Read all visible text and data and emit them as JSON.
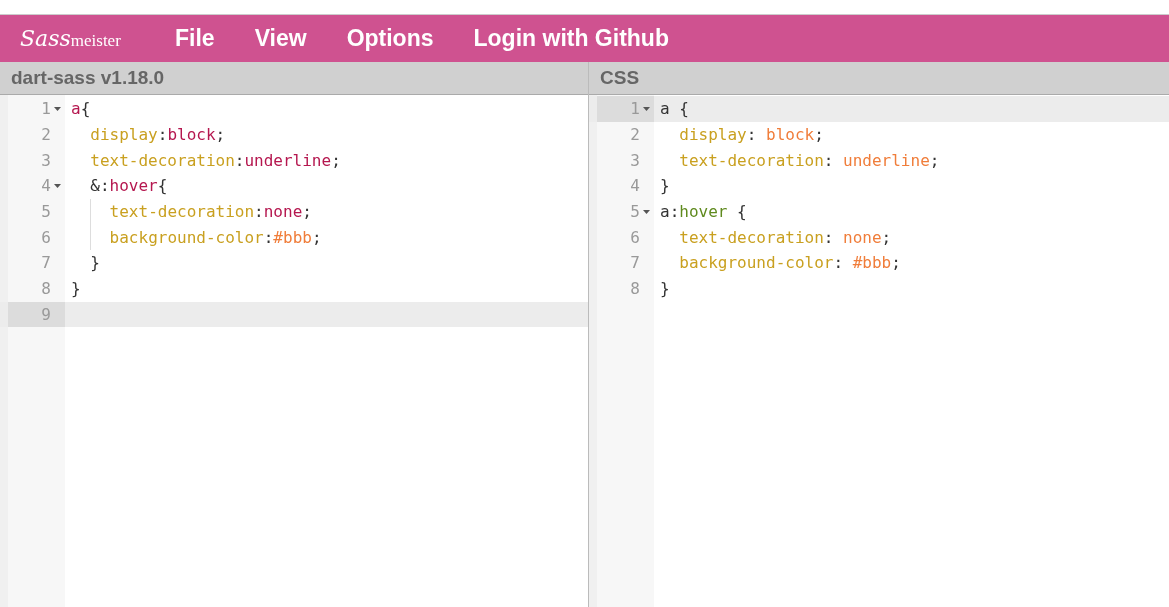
{
  "header": {
    "logo": {
      "script": "Sass",
      "rest": "meister"
    },
    "menu": [
      "File",
      "View",
      "Options",
      "Login with Github"
    ]
  },
  "panes": [
    {
      "title": "dart-sass v1.18.0",
      "lines": [
        {
          "number": "1",
          "foldable": true,
          "active": false,
          "indent": false,
          "guide": false,
          "tokens": [
            {
              "kind": "tag",
              "text": "a"
            },
            {
              "kind": "plain",
              "text": "{"
            }
          ]
        },
        {
          "number": "2",
          "foldable": false,
          "active": false,
          "indent": true,
          "guide": false,
          "tokens": [
            {
              "kind": "prop",
              "text": "display"
            },
            {
              "kind": "plain",
              "text": ":"
            },
            {
              "kind": "atom",
              "text": "block"
            },
            {
              "kind": "plain",
              "text": ";"
            }
          ]
        },
        {
          "number": "3",
          "foldable": false,
          "active": false,
          "indent": true,
          "guide": false,
          "tokens": [
            {
              "kind": "prop",
              "text": "text-decoration"
            },
            {
              "kind": "plain",
              "text": ":"
            },
            {
              "kind": "atom",
              "text": "underline"
            },
            {
              "kind": "plain",
              "text": ";"
            }
          ]
        },
        {
          "number": "4",
          "foldable": true,
          "active": false,
          "indent": true,
          "guide": false,
          "tokens": [
            {
              "kind": "plain",
              "text": "&:"
            },
            {
              "kind": "tag",
              "text": "hover"
            },
            {
              "kind": "plain",
              "text": "{"
            }
          ]
        },
        {
          "number": "5",
          "foldable": false,
          "active": false,
          "indent": true,
          "guide": true,
          "tokens": [
            {
              "kind": "prop",
              "text": "text-decoration"
            },
            {
              "kind": "plain",
              "text": ":"
            },
            {
              "kind": "atom",
              "text": "none"
            },
            {
              "kind": "plain",
              "text": ";"
            }
          ]
        },
        {
          "number": "6",
          "foldable": false,
          "active": false,
          "indent": true,
          "guide": true,
          "tokens": [
            {
              "kind": "prop",
              "text": "background-color"
            },
            {
              "kind": "plain",
              "text": ":"
            },
            {
              "kind": "value",
              "text": "#bbb"
            },
            {
              "kind": "plain",
              "text": ";"
            }
          ]
        },
        {
          "number": "7",
          "foldable": false,
          "active": false,
          "indent": true,
          "guide": false,
          "tokens": [
            {
              "kind": "plain",
              "text": "}"
            }
          ]
        },
        {
          "number": "8",
          "foldable": false,
          "active": false,
          "indent": false,
          "guide": false,
          "tokens": [
            {
              "kind": "plain",
              "text": "}"
            }
          ]
        },
        {
          "number": "9",
          "foldable": false,
          "active": true,
          "indent": false,
          "guide": false
        }
      ]
    },
    {
      "title": "CSS",
      "lines": [
        {
          "number": "1",
          "foldable": true,
          "active": true,
          "indent": false,
          "guide": false,
          "tokens": [
            {
              "kind": "plain",
              "text": "a {"
            }
          ]
        },
        {
          "number": "2",
          "foldable": false,
          "active": false,
          "indent": true,
          "guide": false,
          "tokens": [
            {
              "kind": "prop",
              "text": "display"
            },
            {
              "kind": "plain",
              "text": ": "
            },
            {
              "kind": "value",
              "text": "block"
            },
            {
              "kind": "plain",
              "text": ";"
            }
          ]
        },
        {
          "number": "3",
          "foldable": false,
          "active": false,
          "indent": true,
          "guide": false,
          "tokens": [
            {
              "kind": "prop",
              "text": "text-decoration"
            },
            {
              "kind": "plain",
              "text": ": "
            },
            {
              "kind": "value",
              "text": "underline"
            },
            {
              "kind": "plain",
              "text": ";"
            }
          ]
        },
        {
          "number": "4",
          "foldable": false,
          "active": false,
          "indent": false,
          "guide": false,
          "tokens": [
            {
              "kind": "plain",
              "text": "}"
            }
          ]
        },
        {
          "number": "5",
          "foldable": true,
          "active": false,
          "indent": false,
          "guide": false,
          "tokens": [
            {
              "kind": "plain",
              "text": "a:"
            },
            {
              "kind": "qualifier",
              "text": "hover"
            },
            {
              "kind": "plain",
              "text": " {"
            }
          ]
        },
        {
          "number": "6",
          "foldable": false,
          "active": false,
          "indent": true,
          "guide": false,
          "tokens": [
            {
              "kind": "prop",
              "text": "text-decoration"
            },
            {
              "kind": "plain",
              "text": ": "
            },
            {
              "kind": "value",
              "text": "none"
            },
            {
              "kind": "plain",
              "text": ";"
            }
          ]
        },
        {
          "number": "7",
          "foldable": false,
          "active": false,
          "indent": true,
          "guide": false,
          "tokens": [
            {
              "kind": "prop",
              "text": "background-color"
            },
            {
              "kind": "plain",
              "text": ": "
            },
            {
              "kind": "value",
              "text": "#bbb"
            },
            {
              "kind": "plain",
              "text": ";"
            }
          ]
        },
        {
          "number": "8",
          "foldable": false,
          "active": false,
          "indent": false,
          "guide": false,
          "tokens": [
            {
              "kind": "plain",
              "text": "}"
            }
          ]
        }
      ]
    }
  ]
}
